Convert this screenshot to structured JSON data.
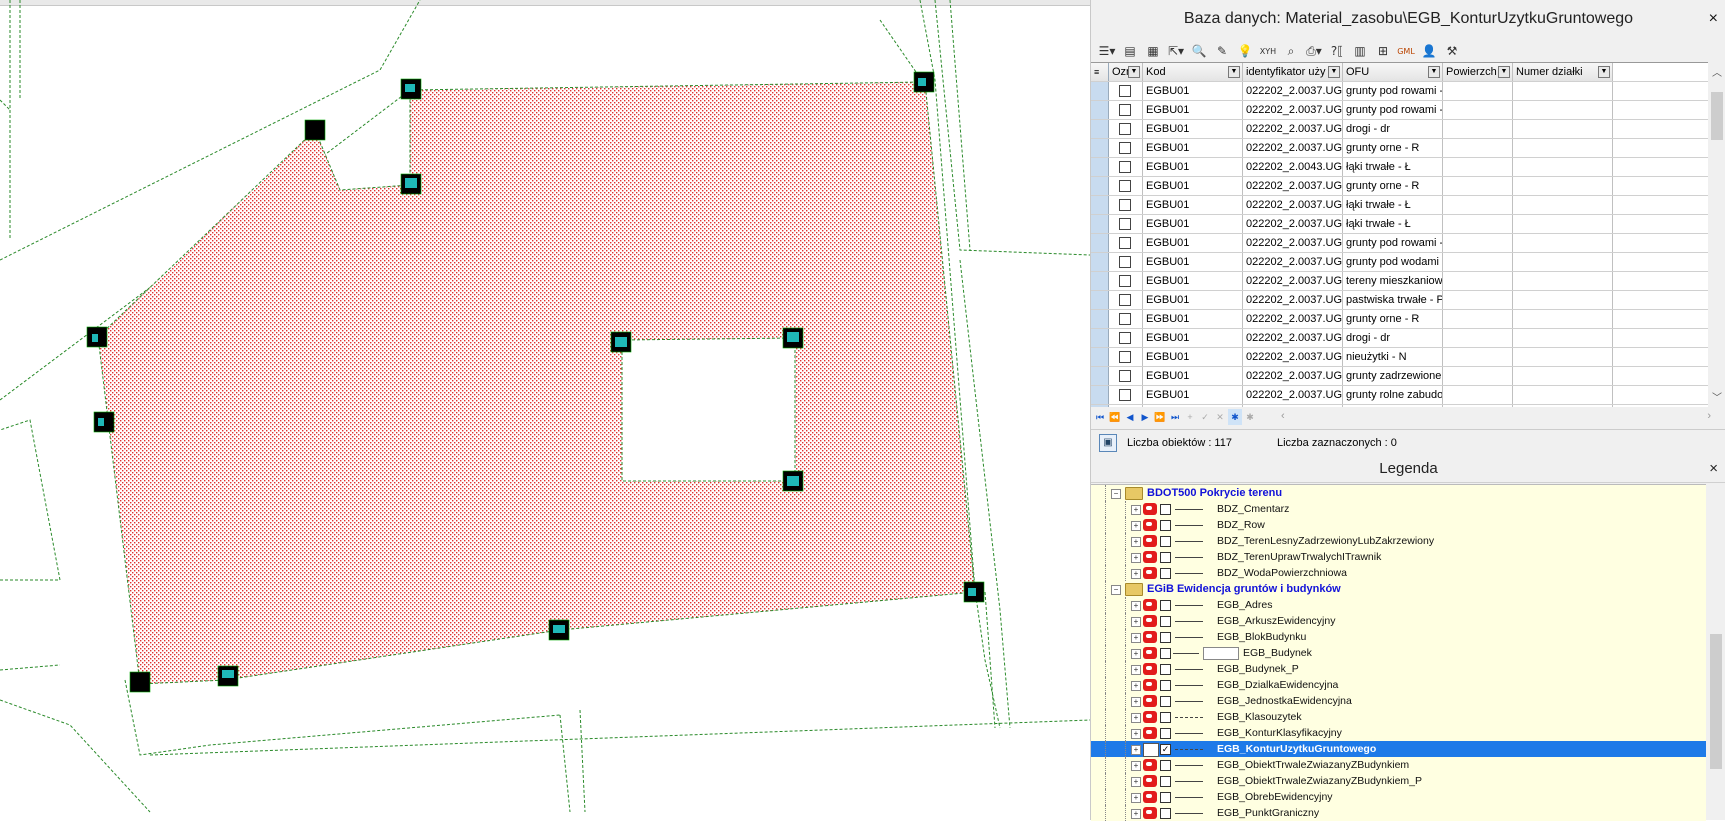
{
  "db_panel": {
    "title": "Baza danych: Material_zasobu\\EGB_KonturUzytkuGruntowego",
    "close": "×",
    "toolbar_icons": [
      "grid-menu-icon",
      "table-icon",
      "table2-icon",
      "export-icon",
      "search-icon",
      "brush-icon",
      "bulb-icon",
      "xyh-icon",
      "zoom-icon",
      "print-icon",
      "query-icon",
      "grid3-icon",
      "filter-icon",
      "gml-icon",
      "users-icon",
      "tool-icon"
    ],
    "xyh_label": "XYH",
    "gml_label": "GML",
    "columns": [
      "Ozr",
      "Kod",
      "identyfikator uży",
      "OFU",
      "Powierzch",
      "Numer działki"
    ],
    "rows": [
      {
        "kod": "EGBU01",
        "id": "022202_2.0037.UG",
        "ofu": "grunty pod rowami -"
      },
      {
        "kod": "EGBU01",
        "id": "022202_2.0037.UG",
        "ofu": "grunty pod rowami -"
      },
      {
        "kod": "EGBU01",
        "id": "022202_2.0037.UG",
        "ofu": "drogi - dr"
      },
      {
        "kod": "EGBU01",
        "id": "022202_2.0037.UG",
        "ofu": "grunty orne - R"
      },
      {
        "kod": "EGBU01",
        "id": "022202_2.0043.UG",
        "ofu": "łąki trwałe - Ł"
      },
      {
        "kod": "EGBU01",
        "id": "022202_2.0037.UG",
        "ofu": "grunty orne - R"
      },
      {
        "kod": "EGBU01",
        "id": "022202_2.0037.UG",
        "ofu": "łąki trwałe - Ł"
      },
      {
        "kod": "EGBU01",
        "id": "022202_2.0037.UG",
        "ofu": "łąki trwałe - Ł"
      },
      {
        "kod": "EGBU01",
        "id": "022202_2.0037.UG",
        "ofu": "grunty pod rowami -"
      },
      {
        "kod": "EGBU01",
        "id": "022202_2.0037.UG",
        "ofu": "grunty pod wodami p"
      },
      {
        "kod": "EGBU01",
        "id": "022202_2.0037.UG",
        "ofu": "tereny mieszkaniowe"
      },
      {
        "kod": "EGBU01",
        "id": "022202_2.0037.UG",
        "ofu": "pastwiska trwałe - P"
      },
      {
        "kod": "EGBU01",
        "id": "022202_2.0037.UG",
        "ofu": "grunty orne - R"
      },
      {
        "kod": "EGBU01",
        "id": "022202_2.0037.UG",
        "ofu": "drogi - dr"
      },
      {
        "kod": "EGBU01",
        "id": "022202_2.0037.UG",
        "ofu": "nieużytki - N"
      },
      {
        "kod": "EGBU01",
        "id": "022202_2.0037.UG",
        "ofu": "grunty zadrzewione"
      },
      {
        "kod": "EGBU01",
        "id": "022202_2.0037.UG",
        "ofu": "grunty rolne zabudo"
      },
      {
        "kod": "EGBU01",
        "id": "022202_2.0037.UG",
        "ofu": "grunty orne - R"
      }
    ],
    "status_count": "Liczba obiektów : 117",
    "status_selected": "Liczba zaznaczonych : 0"
  },
  "legend": {
    "title": "Legenda",
    "close": "×",
    "groups": [
      {
        "name": "BDOT500 Pokrycie terenu",
        "layers": [
          {
            "name": "BDZ_Cmentarz",
            "sym": "line"
          },
          {
            "name": "BDZ_Row",
            "sym": "line"
          },
          {
            "name": "BDZ_TerenLesnyZadrzewionyLubZakrzewiony",
            "sym": "line"
          },
          {
            "name": "BDZ_TerenUprawTrwalychITrawnik",
            "sym": "line"
          },
          {
            "name": "BDZ_WodaPowierzchniowa",
            "sym": "line"
          }
        ]
      },
      {
        "name": "EGiB Ewidencja gruntów i budynków",
        "layers": [
          {
            "name": "EGB_Adres",
            "sym": "line"
          },
          {
            "name": "EGB_ArkuszEwidencyjny",
            "sym": "line"
          },
          {
            "name": "EGB_BlokBudynku",
            "sym": "line"
          },
          {
            "name": "EGB_Budynek",
            "sym": "box"
          },
          {
            "name": "EGB_Budynek_P",
            "sym": "line"
          },
          {
            "name": "EGB_DzialkaEwidencyjna",
            "sym": "line"
          },
          {
            "name": "EGB_JednostkaEwidencyjna",
            "sym": "line"
          },
          {
            "name": "EGB_Klasouzytek",
            "sym": "dash"
          },
          {
            "name": "EGB_KonturKlasyfikacyjny",
            "sym": "line"
          },
          {
            "name": "EGB_KonturUzytkuGruntowego",
            "sym": "dash",
            "selected": true,
            "checked": true
          },
          {
            "name": "EGB_ObiektTrwaleZwiazanyZBudynkiem",
            "sym": "line"
          },
          {
            "name": "EGB_ObiektTrwaleZwiazanyZBudynkiem_P",
            "sym": "line"
          },
          {
            "name": "EGB_ObrebEwidencyjny",
            "sym": "line"
          },
          {
            "name": "EGB_PunktGraniczny",
            "sym": "line"
          }
        ]
      }
    ]
  },
  "colors": {
    "hatch": "#e03030",
    "boundary": "#1a8a1a",
    "selection": "#1e7ae8",
    "legend_bg": "#ffffe1"
  }
}
